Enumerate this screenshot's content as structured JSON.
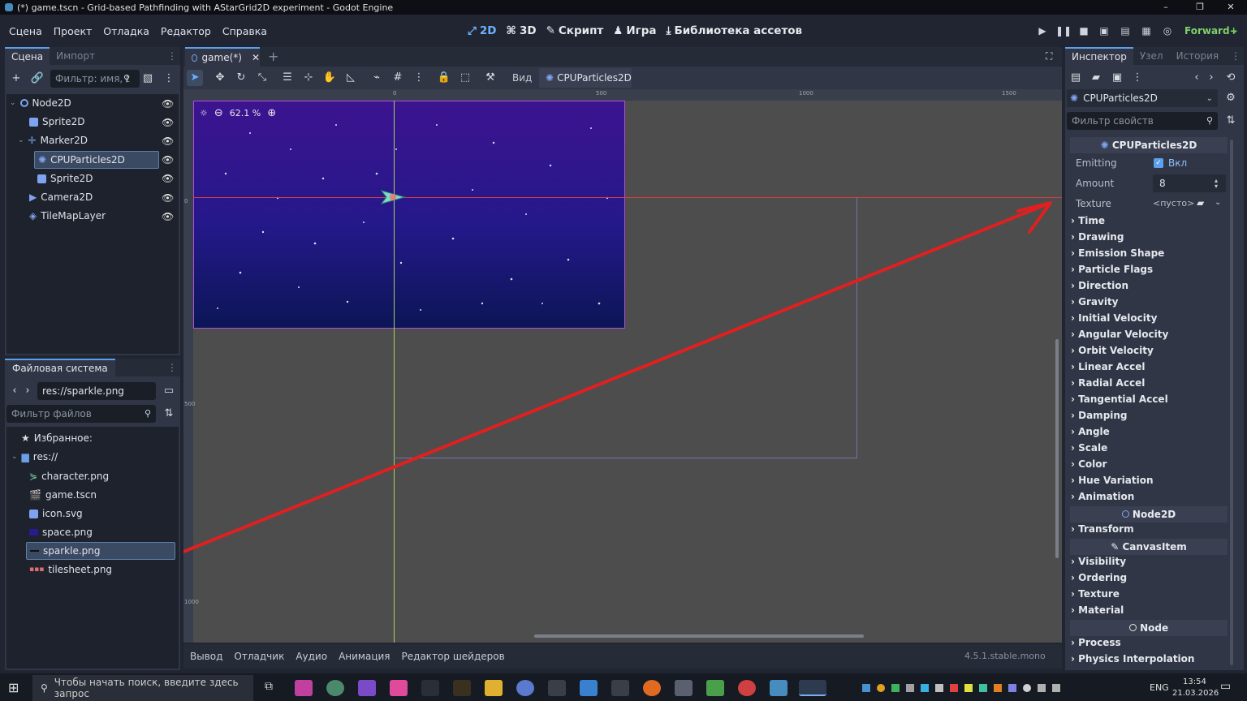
{
  "window": {
    "title": "(*) game.tscn - Grid-based Pathfinding with AStarGrid2D experiment - Godot Engine",
    "minimize": "–",
    "maximize": "❐",
    "close": "✕"
  },
  "menu": [
    "Сцена",
    "Проект",
    "Отладка",
    "Редактор",
    "Справка"
  ],
  "workspaces": [
    {
      "label": "2D",
      "icon": "2d-icon",
      "active": true
    },
    {
      "label": "3D",
      "icon": "3d-icon",
      "active": false
    },
    {
      "label": "Скрипт",
      "icon": "script-icon",
      "active": false
    },
    {
      "label": "Игра",
      "icon": "game-icon",
      "active": false
    },
    {
      "label": "Библиотека ассетов",
      "icon": "asset-library-icon",
      "active": false
    }
  ],
  "renderer": "Forward+",
  "scene_dock": {
    "tabs": [
      "Сцена",
      "Импорт"
    ],
    "filter_placeholder": "Фильтр: имя, t",
    "nodes": [
      {
        "name": "Node2D",
        "icon": "node2d-icon"
      },
      {
        "name": "Sprite2D",
        "icon": "sprite2d-icon"
      },
      {
        "name": "Marker2D",
        "icon": "marker2d-icon"
      },
      {
        "name": "CPUParticles2D",
        "icon": "cpuparticles2d-icon",
        "selected": true
      },
      {
        "name": "Sprite2D",
        "icon": "sprite2d-icon"
      },
      {
        "name": "Camera2D",
        "icon": "camera2d-icon"
      },
      {
        "name": "TileMapLayer",
        "icon": "tilemaplayer-icon"
      }
    ]
  },
  "filesystem": {
    "title": "Файловая система",
    "path": "res://sparkle.png",
    "filter_placeholder": "Фильтр файлов",
    "favorites": "Избранное:",
    "root": "res://",
    "files": [
      {
        "name": "character.png",
        "icon": "image-icon"
      },
      {
        "name": "game.tscn",
        "icon": "scene-icon"
      },
      {
        "name": "icon.svg",
        "icon": "svg-icon"
      },
      {
        "name": "space.png",
        "icon": "image-icon"
      },
      {
        "name": "sparkle.png",
        "icon": "image-icon",
        "selected": true
      },
      {
        "name": "tilesheet.png",
        "icon": "image-icon"
      }
    ]
  },
  "editor_tabs": [
    {
      "label": "game(*)",
      "active": true
    }
  ],
  "toolbar": {
    "view_label": "Вид",
    "node_label": "CPUParticles2D"
  },
  "viewport": {
    "zoom": "62.1 %",
    "ruler_top": [
      "0",
      "500",
      "1000",
      "1500"
    ],
    "ruler_left": [
      "0",
      "500",
      "1000"
    ]
  },
  "bottom_panel": {
    "tabs": [
      "Вывод",
      "Отладчик",
      "Аудио",
      "Анимация",
      "Редактор шейдеров"
    ],
    "version": "4.5.1.stable.mono"
  },
  "inspector": {
    "tabs": [
      "Инспектор",
      "Узел",
      "История"
    ],
    "object": "CPUParticles2D",
    "filter_placeholder": "Фильтр свойств",
    "class_header": "CPUParticles2D",
    "emitting": {
      "label": "Emitting",
      "value": "Вкл"
    },
    "amount": {
      "label": "Amount",
      "value": "8"
    },
    "texture": {
      "label": "Texture",
      "value": "<пусто>"
    },
    "sections1": [
      "Time",
      "Drawing",
      "Emission Shape",
      "Particle Flags",
      "Direction",
      "Gravity",
      "Initial Velocity",
      "Angular Velocity",
      "Orbit Velocity",
      "Linear Accel",
      "Radial Accel",
      "Tangential Accel",
      "Damping",
      "Angle",
      "Scale",
      "Color",
      "Hue Variation",
      "Animation"
    ],
    "cat_node2d": "Node2D",
    "sections2": [
      "Transform"
    ],
    "cat_canvasitem": "CanvasItem",
    "sections3": [
      "Visibility",
      "Ordering",
      "Texture",
      "Material"
    ],
    "cat_node": "Node",
    "sections4": [
      "Process",
      "Physics Interpolation"
    ]
  },
  "taskbar": {
    "search_placeholder": "Чтобы начать поиск, введите здесь запрос",
    "lang": "ENG",
    "time": "13:54",
    "date": "21.03.2026"
  },
  "colors": {
    "accent": "#5aa0ec",
    "arrow": "#e02020",
    "space_top": "#3a1a8a",
    "space_bottom": "#0a1250"
  }
}
